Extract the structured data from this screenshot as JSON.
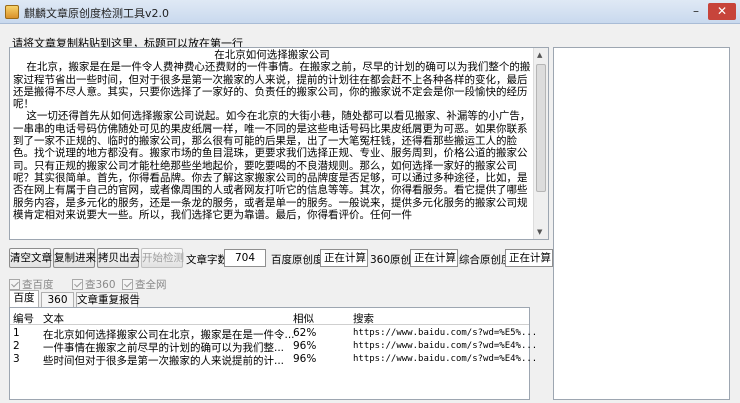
{
  "window": {
    "title": "麒麟文章原创度检测工具v2.0",
    "minimize": "–",
    "close": "✕"
  },
  "instruction": "请将文章复制粘贴到这里，标题可以放在第一行",
  "article": {
    "title": "在北京如何选择搬家公司",
    "body": "    在北京，搬家是在是一件令人费神费心还费财的一件事情。在搬家之前，尽早的计划的确可以为我们整个的搬家过程节省出一些时间，但对于很多是第一次搬家的人来说，提前的计划往在都会赶不上各种各样的变化，最后还是搬得不尽人意。其实，只要你选择了一家好的、负责任的搬家公司，你的搬家说不定会是你一段愉快的经历呢！\n    这一切还得首先从如何选择搬家公司说起。如今在北京的大街小巷，随处都可以看见搬家、补漏等的小广告，一串串的电话号码仿佛随处可见的果皮纸屑一样，唯一不同的是这些电话号码比果皮纸屑更为可恶。如果你联系到了一家不正规的、临时的搬家公司，那么很有可能的后果是，出了一大笔冤枉钱，还得看那些搬运工人的脸色。找个说理的地方都没有。搬家市场的鱼目混珠，更要求我们选择正规、专业、服务周到，价格公道的搬家公司。只有正规的搬家公司才能杜绝那些坐地起价，要吃要喝的不良潜规则。那么，如何选择一家好的搬家公司呢？其实很简单。首先，你得看品牌。你去了解这家搬家公司的品牌度是否足够，可以通过多种途径，比如，是否在网上有属于自己的官网，或者像周围的人或者网友打听它的信息等等。其次，你得看服务。看它提供了哪些服务内容，是多元化的服务，还是一条龙的服务，或者是单一的服务。一般说来，提供多元化服务的搬家公司规模肯定相对来说要大一些。所以，我们选择它更为靠谱。最后，你得看评价。任何一件"
  },
  "toolbar": {
    "clear": "清空文章",
    "copy_in": "复制进来",
    "copy_out": "拷贝出去",
    "start": "开始检测",
    "word_count_label": "文章字数",
    "word_count": "704",
    "baidu_label": "百度原创度",
    "baidu_value": "正在计算，请稍等",
    "so360_label": "360原创度",
    "so360_value": "正在计算，请稍等",
    "overall_label": "综合原创度",
    "overall_value": "正在计算，请稍等"
  },
  "checks": [
    "查百度",
    "查360",
    "查全网"
  ],
  "tabs": [
    "百度",
    "360",
    "文章重复报告"
  ],
  "table": {
    "headers": [
      "编号",
      "文本",
      "相似",
      "搜索"
    ],
    "rows": [
      [
        "1",
        "在北京如何选择搬家公司在北京，搬家是在是一件令...",
        "62%",
        "https://www.baidu.com/s?wd=%E5%..."
      ],
      [
        "2",
        "一件事情在搬家之前尽早的计划的确可以为我们整...",
        "96%",
        "https://www.baidu.com/s?wd=%E4%..."
      ],
      [
        "3",
        "些时间但对于很多是第一次搬家的人来说提前的计...",
        "96%",
        "https://www.baidu.com/s?wd=%E4%..."
      ]
    ]
  }
}
